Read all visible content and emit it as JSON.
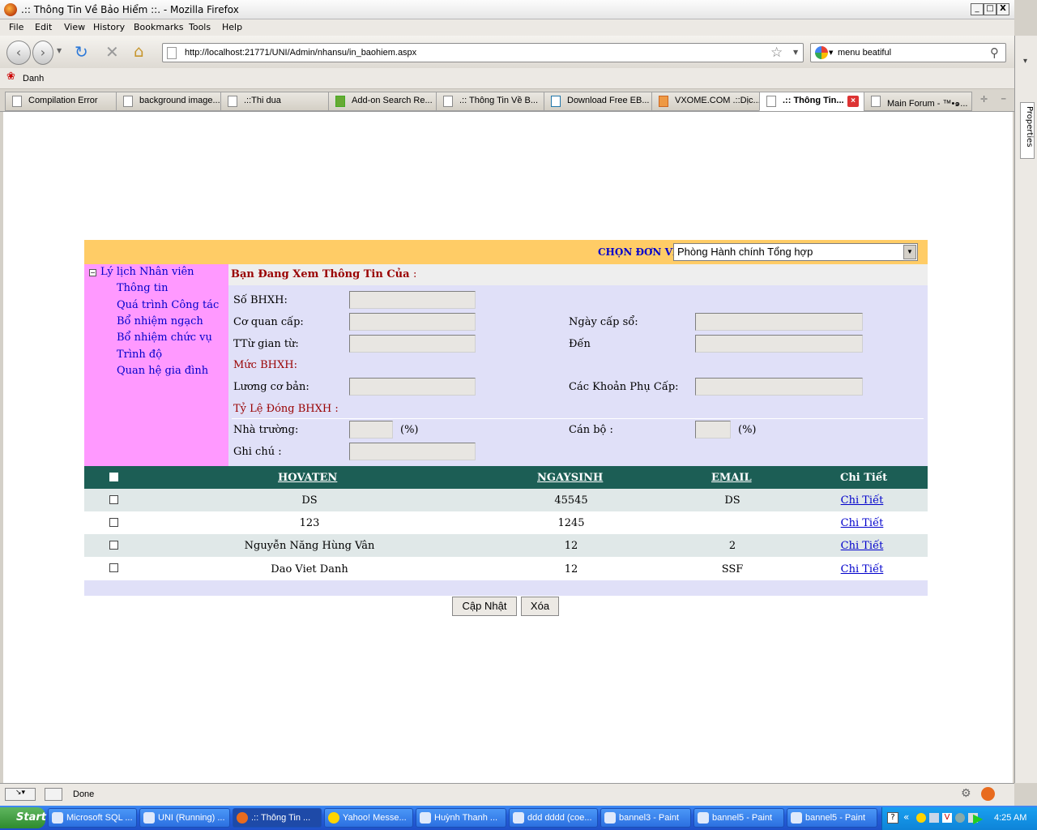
{
  "window": {
    "title": ".:: Thông Tin Về Bảo Hiểm ::. - Mozilla Firefox",
    "min": "_",
    "max": "□",
    "close": "X"
  },
  "menu": [
    "File",
    "Edit",
    "View",
    "History",
    "Bookmarks",
    "Tools",
    "Help"
  ],
  "nav": {
    "url": "http://localhost:21771/UNI/Admin/nhansu/in_baohiem.aspx",
    "search": "menu beatiful"
  },
  "bookmarks": [
    "Danh"
  ],
  "tabs": [
    "Compilation Error",
    "background image...",
    ".::Thi dua",
    "Add-on Search Re...",
    ".:: Thông Tin Về B...",
    "Download Free EB...",
    "VXOME.COM .::Dịc...",
    ".:: Thông Tin...",
    "Main Forum - ™•๑..."
  ],
  "sidebar_panel": "Properties",
  "page": {
    "chon_label": "CHỌN ĐƠN VỊ:",
    "don_vi": "Phòng Hành chính Tổng hợp",
    "menu": {
      "root": "Lý lịch Nhân viên",
      "items": [
        "Thông tin",
        "Quá trình Công tác",
        "Bổ nhiệm ngạch",
        "Bổ nhiệm chức vụ",
        "Trình độ",
        "Quan hệ gia đình"
      ]
    },
    "form": {
      "header": "Bạn Đang Xem Thông Tin Của",
      "header_suffix": ":",
      "so_bhxh": "Số BHXH:",
      "co_quan_cap": "Cơ quan cấp:",
      "ngay_cap_so": "Ngày cấp  sổ:",
      "tu_gian_tu": "TTừ gian từ:",
      "den": "Đến",
      "muc_bhxh": "Mức BHXH:",
      "luong_co_ban": "Lương cơ bản:",
      "phu_cap": "Các Khoản Phụ Cấp:",
      "ty_le": "Tỷ Lệ Đóng BHXH :",
      "nha_truong": "Nhà trường:",
      "can_bo": "Cán bộ :",
      "pct": "(%)",
      "ghi_chu": "Ghi chú :"
    },
    "grid": {
      "headers": [
        "HOVATEN",
        "NGAYSINH",
        "EMAIL",
        "Chi Tiết"
      ],
      "rows": [
        {
          "hovaten": "DS",
          "ngaysinh": "45545",
          "email": "DS",
          "link": "Chi Tiết"
        },
        {
          "hovaten": "123",
          "ngaysinh": "1245",
          "email": "",
          "link": "Chi Tiết"
        },
        {
          "hovaten": "Nguyễn Năng Hùng Vân",
          "ngaysinh": "12",
          "email": "2",
          "link": "Chi Tiết"
        },
        {
          "hovaten": "Dao Viet Danh",
          "ngaysinh": "12",
          "email": "SSF",
          "link": "Chi Tiết"
        }
      ]
    },
    "buttons": {
      "update": "Cập Nhật",
      "delete": "Xóa"
    }
  },
  "status": "Done",
  "taskbar": {
    "start": "Start",
    "tasks": [
      "Microsoft SQL ...",
      "UNI (Running) ...",
      ".:: Thông Tin ...",
      "Yahoo! Messe...",
      "Huỳnh Thanh ...",
      "ddd dddd (coe...",
      "bannel3 - Paint",
      "bannel5 - Paint",
      "bannel5 - Paint"
    ],
    "clock": "4:25 AM"
  }
}
